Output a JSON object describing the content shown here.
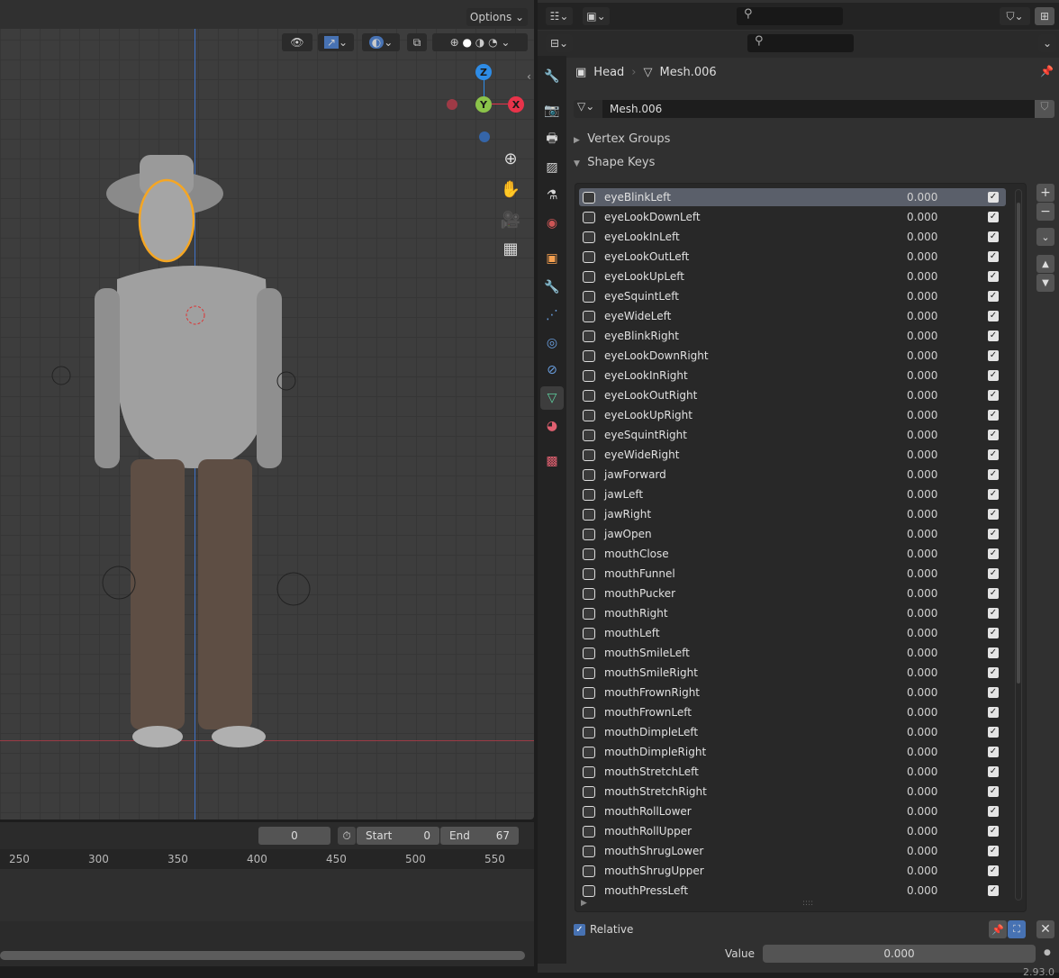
{
  "viewport": {
    "options_label": "Options",
    "gizmo": {
      "z": "Z",
      "y": "Y",
      "x": "X"
    }
  },
  "timeline": {
    "current_frame": "0",
    "start_label": "Start",
    "start": "0",
    "end_label": "End",
    "end": "67",
    "ticks": [
      "250",
      "300",
      "350",
      "400",
      "450",
      "500",
      "550"
    ]
  },
  "properties": {
    "breadcrumb": {
      "object": "Head",
      "mesh": "Mesh.006"
    },
    "mesh_name": "Mesh.006",
    "panels": {
      "vertex_groups": "Vertex Groups",
      "shape_keys": "Shape Keys"
    },
    "shape_keys": [
      {
        "name": "eyeBlinkLeft",
        "value": "0.000"
      },
      {
        "name": "eyeLookDownLeft",
        "value": "0.000"
      },
      {
        "name": "eyeLookInLeft",
        "value": "0.000"
      },
      {
        "name": "eyeLookOutLeft",
        "value": "0.000"
      },
      {
        "name": "eyeLookUpLeft",
        "value": "0.000"
      },
      {
        "name": "eyeSquintLeft",
        "value": "0.000"
      },
      {
        "name": "eyeWideLeft",
        "value": "0.000"
      },
      {
        "name": "eyeBlinkRight",
        "value": "0.000"
      },
      {
        "name": "eyeLookDownRight",
        "value": "0.000"
      },
      {
        "name": "eyeLookInRight",
        "value": "0.000"
      },
      {
        "name": "eyeLookOutRight",
        "value": "0.000"
      },
      {
        "name": "eyeLookUpRight",
        "value": "0.000"
      },
      {
        "name": "eyeSquintRight",
        "value": "0.000"
      },
      {
        "name": "eyeWideRight",
        "value": "0.000"
      },
      {
        "name": "jawForward",
        "value": "0.000"
      },
      {
        "name": "jawLeft",
        "value": "0.000"
      },
      {
        "name": "jawRight",
        "value": "0.000"
      },
      {
        "name": "jawOpen",
        "value": "0.000"
      },
      {
        "name": "mouthClose",
        "value": "0.000"
      },
      {
        "name": "mouthFunnel",
        "value": "0.000"
      },
      {
        "name": "mouthPucker",
        "value": "0.000"
      },
      {
        "name": "mouthRight",
        "value": "0.000"
      },
      {
        "name": "mouthLeft",
        "value": "0.000"
      },
      {
        "name": "mouthSmileLeft",
        "value": "0.000"
      },
      {
        "name": "mouthSmileRight",
        "value": "0.000"
      },
      {
        "name": "mouthFrownRight",
        "value": "0.000"
      },
      {
        "name": "mouthFrownLeft",
        "value": "0.000"
      },
      {
        "name": "mouthDimpleLeft",
        "value": "0.000"
      },
      {
        "name": "mouthDimpleRight",
        "value": "0.000"
      },
      {
        "name": "mouthStretchLeft",
        "value": "0.000"
      },
      {
        "name": "mouthStretchRight",
        "value": "0.000"
      },
      {
        "name": "mouthRollLower",
        "value": "0.000"
      },
      {
        "name": "mouthRollUpper",
        "value": "0.000"
      },
      {
        "name": "mouthShrugLower",
        "value": "0.000"
      },
      {
        "name": "mouthShrugUpper",
        "value": "0.000"
      },
      {
        "name": "mouthPressLeft",
        "value": "0.000"
      }
    ],
    "relative_label": "Relative",
    "value_label": "Value",
    "value": "0.000"
  },
  "status": {
    "version": "2.93.0"
  },
  "colors": {
    "accent": "#4772b3",
    "selection": "#f5a623",
    "x_axis": "#e8334a",
    "y_axis": "#8bc34a",
    "z_axis": "#2e8ce6"
  }
}
